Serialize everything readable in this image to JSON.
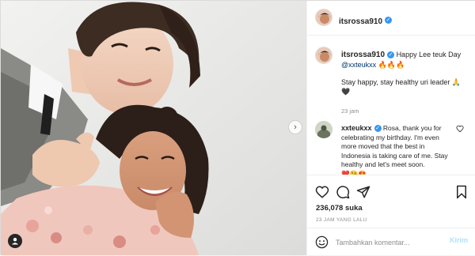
{
  "post": {
    "author": "itsrossa910",
    "verified_mark": "✓",
    "caption": {
      "text": "Happy Lee teuk Day",
      "mention": "@xxteukxx",
      "mention_emoji": "🔥🔥🔥",
      "body": "Stay happy, stay healthy uri leader 🙏",
      "heart": "🖤",
      "time": "23 jam"
    },
    "reply": {
      "author": "xxteukxx",
      "text": "Rosa, thank you for celebrating my birthday. I'm even more moved that the best in Indonesia is taking care of me. Stay healthy and let's meet soon.",
      "emoji": "❤️😘😍"
    },
    "likes": "236,078 suka",
    "posted_ago": "23 JAM YANG LALU",
    "comment_box": {
      "placeholder": "Tambahkan komentar...",
      "submit_label": "Kirim"
    }
  },
  "photo": {
    "next_arrow": "›"
  },
  "icons": [
    "next-arrow-icon",
    "tag-user-icon",
    "verified-icon",
    "heart-icon",
    "comment-icon",
    "share-icon",
    "bookmark-icon",
    "emoji-icon",
    "like-comment-icon"
  ],
  "colors": {
    "link": "#00376b",
    "verified": "#3897f0",
    "muted": "#8e8e8e",
    "post_button_disabled": "#b2dffc"
  }
}
